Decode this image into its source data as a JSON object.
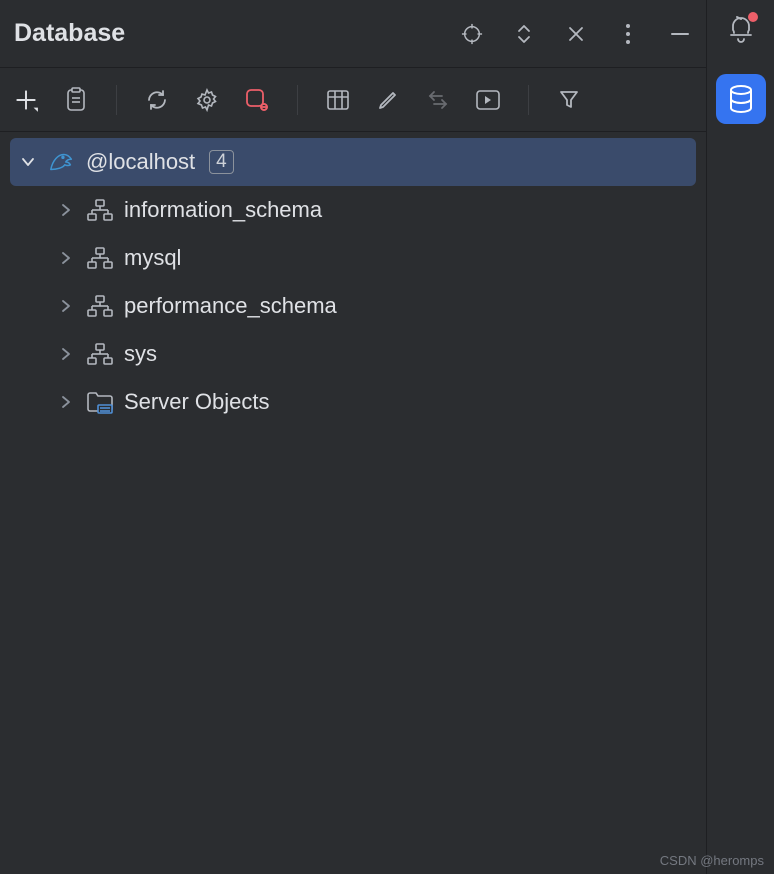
{
  "header": {
    "title": "Database"
  },
  "connection": {
    "name": "@localhost",
    "count": "4"
  },
  "schemas": [
    {
      "label": "information_schema"
    },
    {
      "label": "mysql"
    },
    {
      "label": "performance_schema"
    },
    {
      "label": "sys"
    }
  ],
  "server_objects": {
    "label": "Server Objects"
  },
  "watermark": "CSDN @heromps"
}
